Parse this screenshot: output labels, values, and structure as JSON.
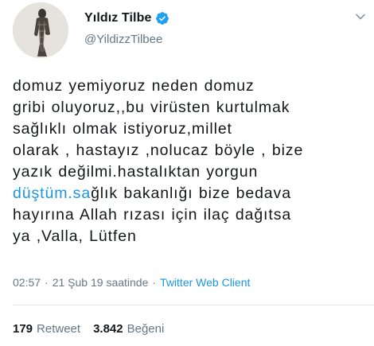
{
  "tweet": {
    "author": {
      "display_name": "Yıldız Tilbe",
      "handle": "@YildizzTilbee",
      "verified": true,
      "verified_color": "#1da1f2",
      "avatar_icon": "profile-photo"
    },
    "text_before_link": "domuz yemiyoruz neden domuz\ngribi oluyoruz,,bu virüsten kurtulmak\nsağlıklı olmak istiyoruz,millet\nolarak , hastayız ,nolucaz böyle , bize\nyazık değilmi.hastalıktan yorgun\n",
    "link_text": "düştüm.sa",
    "text_after_link": "ğlık bakanlığı bize bedava\nhayırına Allah rızası için ilaç dağıtsa\nya ,Valla, Lütfen",
    "time": "02:57",
    "date": "21 Şub 19 saatinde",
    "separator": "·",
    "client": "Twitter Web Client",
    "stats": {
      "retweets_count": "179",
      "retweets_label": "Retweet",
      "likes_count": "3.842",
      "likes_label": "Beğeni"
    },
    "menu_icon": "chevron-down-icon",
    "colors": {
      "link": "#1b95e0",
      "secondary_text": "#657786",
      "primary_text": "#14171a"
    }
  }
}
